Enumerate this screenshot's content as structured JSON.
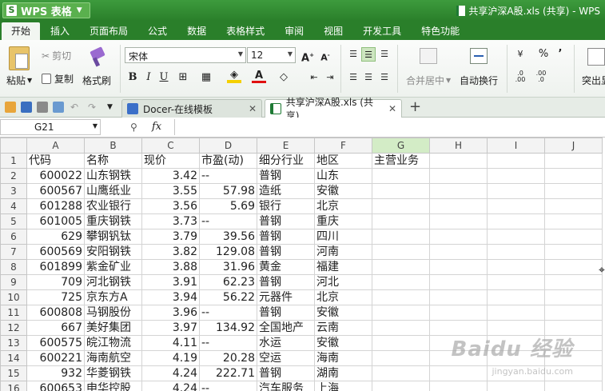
{
  "titlebar": {
    "app_name": "WPS 表格",
    "app_logo": "S",
    "doc_title": "共享沪深A股.xls (共享) - WPS"
  },
  "menu": [
    "开始",
    "插入",
    "页面布局",
    "公式",
    "数据",
    "表格样式",
    "审阅",
    "视图",
    "开发工具",
    "特色功能"
  ],
  "ribbon": {
    "paste": "粘贴",
    "cut": "剪切",
    "copy": "复制",
    "format_painter": "格式刷",
    "font_name": "宋体",
    "font_size": "12",
    "bold": "B",
    "italic": "I",
    "underline": "U",
    "merge_center": "合并居中",
    "wrap_text": "自动换行",
    "percent": "%",
    "thousands": "’",
    "dec_inc": ".0\n.00",
    "dec_dec": ".00\n.0",
    "highlight": "突出显"
  },
  "tabs": [
    {
      "label": "Docer-在线模板"
    },
    {
      "label": "共享沪深A股.xls (共享)"
    }
  ],
  "formula_bar": {
    "cell_ref": "G21",
    "fx": "fx",
    "value": ""
  },
  "sheet": {
    "columns": [
      "A",
      "B",
      "C",
      "D",
      "E",
      "F",
      "G",
      "H",
      "I",
      "J"
    ],
    "selected_column": "G",
    "rows": [
      {
        "n": "1",
        "cells": [
          "代码",
          "名称",
          "现价",
          "市盈(动)",
          "细分行业",
          "地区",
          "主营业务"
        ]
      },
      {
        "n": "2",
        "cells": [
          "600022",
          "山东钢铁",
          "3.42",
          "--",
          "普钢",
          "山东",
          ""
        ]
      },
      {
        "n": "3",
        "cells": [
          "600567",
          "山鹰纸业",
          "3.55",
          "57.98",
          "造纸",
          "安徽",
          ""
        ]
      },
      {
        "n": "4",
        "cells": [
          "601288",
          "农业银行",
          "3.56",
          "5.69",
          "银行",
          "北京",
          ""
        ]
      },
      {
        "n": "5",
        "cells": [
          "601005",
          "重庆钢铁",
          "3.73",
          "--",
          "普钢",
          "重庆",
          ""
        ]
      },
      {
        "n": "6",
        "cells": [
          "629",
          "攀钢钒钛",
          "3.79",
          "39.56",
          "普钢",
          "四川",
          ""
        ]
      },
      {
        "n": "7",
        "cells": [
          "600569",
          "安阳钢铁",
          "3.82",
          "129.08",
          "普钢",
          "河南",
          ""
        ]
      },
      {
        "n": "8",
        "cells": [
          "601899",
          "紫金矿业",
          "3.88",
          "31.96",
          "黄金",
          "福建",
          ""
        ]
      },
      {
        "n": "9",
        "cells": [
          "709",
          "河北钢铁",
          "3.91",
          "62.23",
          "普钢",
          "河北",
          ""
        ]
      },
      {
        "n": "10",
        "cells": [
          "725",
          "京东方A",
          "3.94",
          "56.22",
          "元器件",
          "北京",
          ""
        ]
      },
      {
        "n": "11",
        "cells": [
          "600808",
          "马钢股份",
          "3.96",
          "--",
          "普钢",
          "安徽",
          ""
        ]
      },
      {
        "n": "12",
        "cells": [
          "667",
          "美好集团",
          "3.97",
          "134.92",
          "全国地产",
          "云南",
          ""
        ]
      },
      {
        "n": "13",
        "cells": [
          "600575",
          "皖江物流",
          "4.11",
          "--",
          "水运",
          "安徽",
          ""
        ]
      },
      {
        "n": "14",
        "cells": [
          "600221",
          "海南航空",
          "4.19",
          "20.28",
          "空运",
          "海南",
          ""
        ]
      },
      {
        "n": "15",
        "cells": [
          "932",
          "华菱钢铁",
          "4.24",
          "222.71",
          "普钢",
          "湖南",
          ""
        ]
      },
      {
        "n": "16",
        "cells": [
          "600653",
          "申华控股",
          "4.24",
          "--",
          "汽车服务",
          "上海",
          ""
        ]
      }
    ]
  },
  "watermark": {
    "main": "Baidu 经验",
    "sub": "jingyan.baidu.com"
  },
  "colors": {
    "accent": "#2a7f2a",
    "selected_header": "#d3ecc6"
  }
}
